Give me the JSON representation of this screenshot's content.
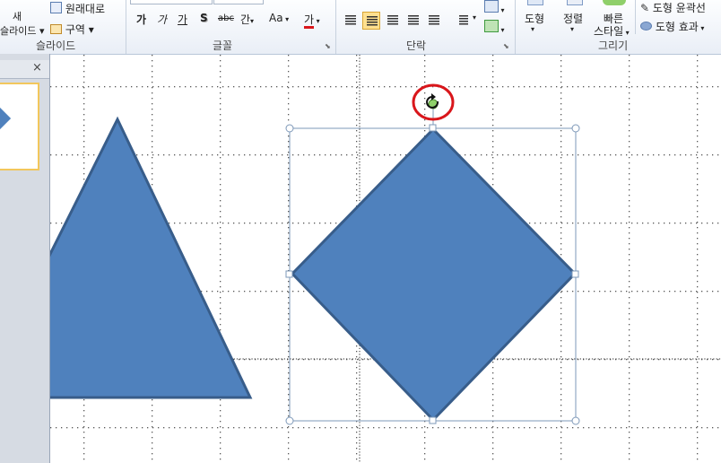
{
  "ribbon": {
    "slides_group": {
      "label": "슬라이드",
      "new_slide_top": "새",
      "new_slide_bottom": "슬라이드",
      "reset": "원래대로",
      "section": "구역"
    },
    "font_group": {
      "label": "글꼴",
      "bold": "가",
      "italic": "가",
      "underline": "가",
      "shadow": "S",
      "strikethrough": "abc",
      "spacing": "간",
      "change_case": "Aa",
      "font_color": "가"
    },
    "paragraph_group": {
      "label": "단락"
    },
    "drawing_group": {
      "label": "그리기",
      "shapes": "도형",
      "arrange": "정렬",
      "quick_styles_top": "빠른",
      "quick_styles_bottom": "스타일",
      "shape_outline": "도형 윤곽선",
      "shape_effects": "도형 효과"
    }
  },
  "sidebar": {
    "close": "×"
  },
  "colors": {
    "shape_fill": "#4f81bd",
    "shape_stroke": "#385d8a",
    "highlight": "#d9161b",
    "accent": "#ffe08f"
  }
}
